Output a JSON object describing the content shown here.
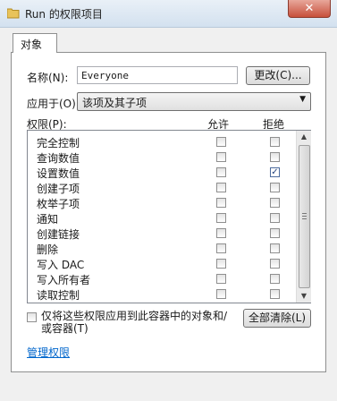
{
  "window": {
    "title": "Run 的权限项目",
    "close_label": "✕"
  },
  "tabs": [
    {
      "label": "对象"
    }
  ],
  "name_field": {
    "label": "名称(N):",
    "value": "Everyone",
    "change_button": "更改(C)..."
  },
  "apply_to": {
    "label": "应用于(O):",
    "value": "该项及其子项"
  },
  "permissions": {
    "header_label": "权限(P):",
    "allow_header": "允许",
    "deny_header": "拒绝",
    "rows": [
      {
        "name": "完全控制",
        "allow": false,
        "deny": false
      },
      {
        "name": "查询数值",
        "allow": false,
        "deny": false
      },
      {
        "name": "设置数值",
        "allow": false,
        "deny": true
      },
      {
        "name": "创建子项",
        "allow": false,
        "deny": false
      },
      {
        "name": "枚举子项",
        "allow": false,
        "deny": false
      },
      {
        "name": "通知",
        "allow": false,
        "deny": false
      },
      {
        "name": "创建链接",
        "allow": false,
        "deny": false
      },
      {
        "name": "删除",
        "allow": false,
        "deny": false
      },
      {
        "name": "写入 DAC",
        "allow": false,
        "deny": false
      },
      {
        "name": "写入所有者",
        "allow": false,
        "deny": false
      },
      {
        "name": "读取控制",
        "allow": false,
        "deny": false
      }
    ]
  },
  "apply_only_label": "仅将这些权限应用到此容器中的对象和/或容器(T)",
  "clear_all_button": "全部清除(L)",
  "manage_link": "管理权限",
  "colors": {
    "link": "#0066cc",
    "close_button": "#c7503b"
  }
}
